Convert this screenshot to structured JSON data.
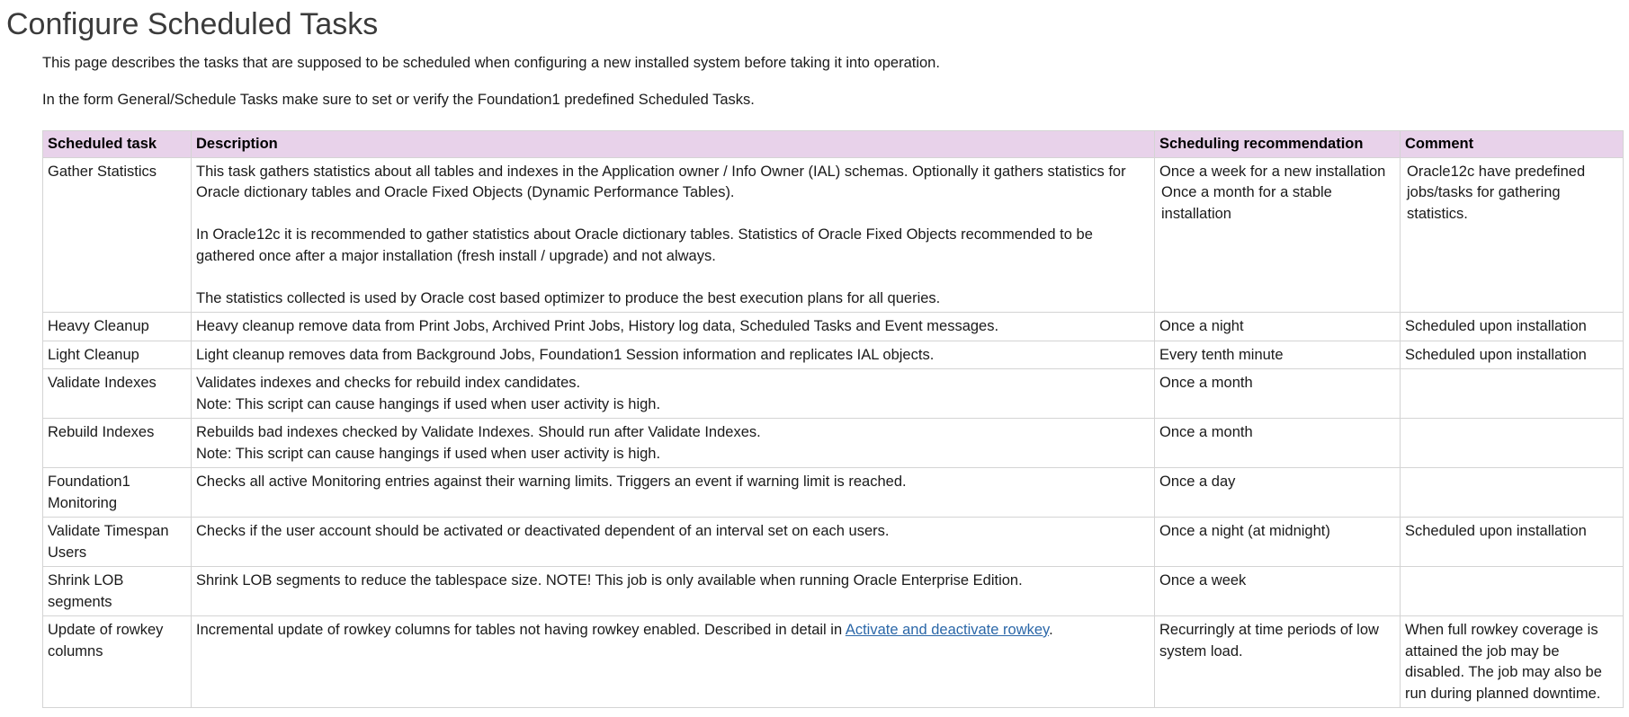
{
  "page": {
    "title": "Configure Scheduled Tasks",
    "intro": [
      "This page describes the tasks that are supposed to be scheduled when configuring a new installed system before taking it into operation.",
      "In the form General/Schedule Tasks make sure to set or verify the Foundation1 predefined Scheduled Tasks."
    ]
  },
  "table": {
    "headers": [
      "Scheduled task",
      "Description",
      "Scheduling recommendation",
      "Comment"
    ],
    "rows": [
      {
        "task": "Gather Statistics",
        "description": [
          "This task gathers statistics about all tables and indexes in the Application owner / Info Owner (IAL) schemas. Optionally it gathers statistics for Oracle dictionary tables and Oracle Fixed Objects (Dynamic Performance Tables).",
          "In Oracle12c it is recommended to gather statistics about Oracle dictionary tables. Statistics of Oracle Fixed Objects recommended to be gathered once after a major installation (fresh install / upgrade) and not always.",
          "The statistics collected is used by Oracle cost based optimizer to produce the best execution plans for all queries."
        ],
        "recommendation": [
          "Once a week for a new installation",
          "Once a month for a stable installation"
        ],
        "comment": "Oracle12c have predefined jobs/tasks for gathering statistics."
      },
      {
        "task": "Heavy Cleanup",
        "description": [
          "Heavy cleanup remove data from Print Jobs, Archived Print Jobs, History log data, Scheduled Tasks and Event messages."
        ],
        "recommendation": [
          "Once a night"
        ],
        "comment": "Scheduled upon installation"
      },
      {
        "task": "Light Cleanup",
        "description": [
          "Light cleanup removes data from Background Jobs, Foundation1 Session information and replicates IAL objects."
        ],
        "recommendation": [
          "Every tenth minute"
        ],
        "comment": "Scheduled upon installation"
      },
      {
        "task": "Validate Indexes",
        "description": [
          "Validates indexes and checks for rebuild index candidates.",
          "Note: This script can cause hangings if used when user activity is high."
        ],
        "recommendation": [
          "Once a month"
        ],
        "comment": ""
      },
      {
        "task": "Rebuild Indexes",
        "description": [
          "Rebuilds bad indexes checked by Validate Indexes. Should run after Validate Indexes.",
          "Note: This script can cause hangings if used when user activity is high."
        ],
        "recommendation": [
          "Once a month"
        ],
        "comment": ""
      },
      {
        "task": "Foundation1 Monitoring",
        "description": [
          "Checks all active Monitoring entries against their warning limits. Triggers an event if warning limit is reached."
        ],
        "recommendation": [
          "Once a day"
        ],
        "comment": ""
      },
      {
        "task": "Validate Timespan Users",
        "description": [
          "Checks if the user account should be activated or deactivated dependent of an interval set on each users."
        ],
        "recommendation": [
          "Once a night (at midnight)"
        ],
        "comment": "Scheduled upon installation"
      },
      {
        "task": "Shrink LOB segments",
        "description": [
          "Shrink LOB segments to reduce the tablespace size. NOTE! This job is only available when running Oracle Enterprise Edition."
        ],
        "recommendation": [
          "Once a week"
        ],
        "comment": ""
      },
      {
        "task": "Update of rowkey columns",
        "description_prefix": "Incremental update of rowkey columns for tables not having rowkey enabled. Described in detail in ",
        "description_link": "Activate and deactivate rowkey",
        "description_suffix": ".",
        "recommendation": [
          "Recurringly at time periods of low system load."
        ],
        "comment": "When full rowkey coverage is attained the job may be disabled. The job may also be run during planned downtime."
      }
    ]
  }
}
